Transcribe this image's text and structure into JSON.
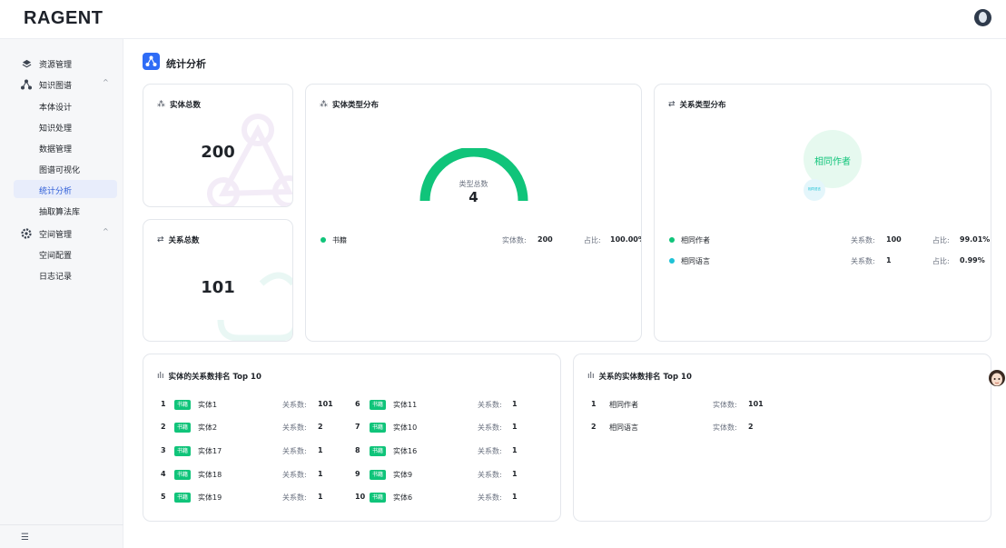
{
  "app": {
    "logo": "RAGENT"
  },
  "sidebar": {
    "groups": [
      {
        "label": "资源管理",
        "icon": "layers-icon"
      },
      {
        "label": "知识图谱",
        "icon": "graph-icon",
        "chevron": "^"
      },
      {
        "label": "空间管理",
        "icon": "settings-icon",
        "chevron": "^"
      }
    ],
    "kg_items": [
      "本体设计",
      "知识处理",
      "数据管理",
      "图谱可视化",
      "统计分析",
      "抽取算法库"
    ],
    "space_items": [
      "空间配置",
      "日志记录"
    ],
    "active": "统计分析",
    "collapse_icon": "menu-fold-icon"
  },
  "page": {
    "title": "统计分析"
  },
  "entity_total": {
    "title": "实体总数",
    "value": "200"
  },
  "relation_total": {
    "title": "关系总数",
    "value": "101"
  },
  "entity_types": {
    "title": "实体类型分布",
    "gauge_label": "类型总数",
    "gauge_value": "4",
    "legend": [
      {
        "name": "书籍",
        "count_label": "实体数:",
        "count": "200",
        "ratio_label": "占比:",
        "ratio": "100.00%",
        "color": "#10c47a"
      }
    ]
  },
  "relation_types": {
    "title": "关系类型分布",
    "bubble_big": "相同作者",
    "bubble_small": "相同语言",
    "legend": [
      {
        "name": "相同作者",
        "count_label": "关系数:",
        "count": "100",
        "ratio_label": "占比:",
        "ratio": "99.01%",
        "color": "#10c47a"
      },
      {
        "name": "相同语言",
        "count_label": "关系数:",
        "count": "1",
        "ratio_label": "占比:",
        "ratio": "0.99%",
        "color": "#1fc2d6"
      }
    ]
  },
  "entity_rank": {
    "title": "实体的关系数排名 Top 10",
    "tag": "书籍",
    "value_label": "关系数:",
    "rows": [
      {
        "rank": "1",
        "name": "实体1",
        "value": "101"
      },
      {
        "rank": "2",
        "name": "实体2",
        "value": "2"
      },
      {
        "rank": "3",
        "name": "实体17",
        "value": "1"
      },
      {
        "rank": "4",
        "name": "实体18",
        "value": "1"
      },
      {
        "rank": "5",
        "name": "实体19",
        "value": "1"
      },
      {
        "rank": "6",
        "name": "实体11",
        "value": "1"
      },
      {
        "rank": "7",
        "name": "实体10",
        "value": "1"
      },
      {
        "rank": "8",
        "name": "实体16",
        "value": "1"
      },
      {
        "rank": "9",
        "name": "实体9",
        "value": "1"
      },
      {
        "rank": "10",
        "name": "实体6",
        "value": "1"
      }
    ]
  },
  "relation_rank": {
    "title": "关系的实体数排名 Top 10",
    "value_label": "实体数:",
    "rows": [
      {
        "rank": "1",
        "name": "相同作者",
        "value": "101"
      },
      {
        "rank": "2",
        "name": "相同语言",
        "value": "2"
      }
    ]
  },
  "colors": {
    "accent": "#2f6cf6",
    "green": "#10c47a",
    "cyan": "#1fc2d6",
    "gauge_track": "#eef0f3"
  }
}
